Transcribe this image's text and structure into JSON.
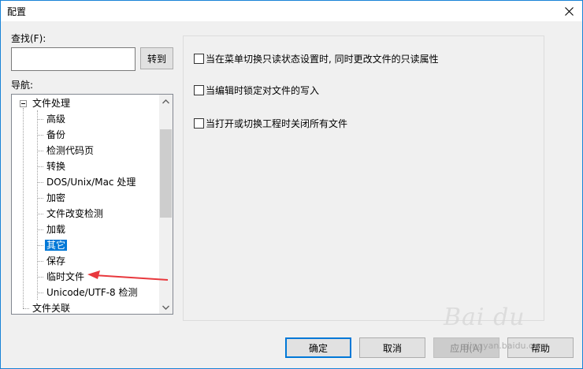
{
  "window": {
    "title": "配置"
  },
  "find": {
    "label": "查找(F):",
    "value": "",
    "go_label": "转到"
  },
  "nav": {
    "label": "导航:",
    "items": [
      {
        "label": "文件处理",
        "level": 0,
        "expanded": true,
        "selected": false
      },
      {
        "label": "高级",
        "level": 1,
        "selected": false
      },
      {
        "label": "备份",
        "level": 1,
        "selected": false
      },
      {
        "label": "检测代码页",
        "level": 1,
        "selected": false
      },
      {
        "label": "转换",
        "level": 1,
        "selected": false
      },
      {
        "label": "DOS/Unix/Mac 处理",
        "level": 1,
        "selected": false
      },
      {
        "label": "加密",
        "level": 1,
        "selected": false
      },
      {
        "label": "文件改变检测",
        "level": 1,
        "selected": false
      },
      {
        "label": "加载",
        "level": 1,
        "selected": false
      },
      {
        "label": "其它",
        "level": 1,
        "selected": true
      },
      {
        "label": "保存",
        "level": 1,
        "selected": false
      },
      {
        "label": "临时文件",
        "level": 1,
        "selected": false
      },
      {
        "label": "Unicode/UTF-8 检测",
        "level": 1,
        "selected": false
      },
      {
        "label": "文件关联",
        "level": 0,
        "selected": false
      }
    ]
  },
  "options": [
    {
      "label": "当在菜单切换只读状态设置时, 同时更改文件的只读属性",
      "checked": false
    },
    {
      "label": "当编辑时锁定对文件的写入",
      "checked": false
    },
    {
      "label": "当打开或切换工程时关闭所有文件",
      "checked": false
    }
  ],
  "buttons": {
    "ok": "确定",
    "cancel": "取消",
    "apply": "应用(A)",
    "help": "帮助"
  },
  "watermark": {
    "brand": "Bai du",
    "sub": "jingyan.baidu.com"
  },
  "colors": {
    "selection": "#0078d7",
    "annotation_arrow": "#e8383d"
  },
  "icons": {
    "close": "close-icon",
    "expander": "minus-box-icon",
    "scroll_up": "chevron-up-icon",
    "scroll_down": "chevron-down-icon"
  }
}
